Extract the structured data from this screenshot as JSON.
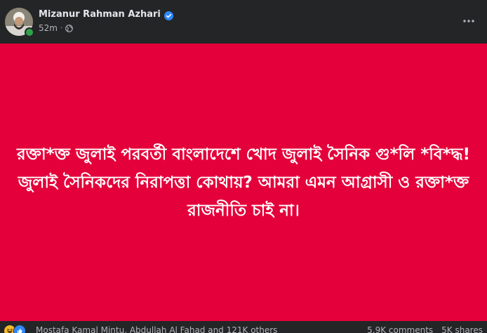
{
  "post": {
    "author": "Mizanur Rahman Azhari",
    "time": "52m",
    "separator": "·",
    "text": "রক্তা*ক্ত জুলাই পরবর্তী বাংলাদেশে খোদ জুলাই সৈনিক গু*লি *বি*দ্ধ! জুলাই সৈনিকদের নিরাপত্তা কোথায়? আমরা এমন আগ্রাসী ও রক্তা*ক্ত রাজনীতি চাই না।",
    "background_color": "#e4003a"
  },
  "reactions": {
    "icons": [
      "haha-icon",
      "like-icon"
    ],
    "names": "Mostafa Kamal Mintu, Abdullah Al Fahad and 121K others",
    "comments": "5.9K comments",
    "shares": "5K shares"
  },
  "colors": {
    "surface": "#242526",
    "primary_text": "#e4e6eb",
    "secondary_text": "#b0b3b8",
    "verified": "#2d88ff",
    "online": "#31a24c"
  }
}
